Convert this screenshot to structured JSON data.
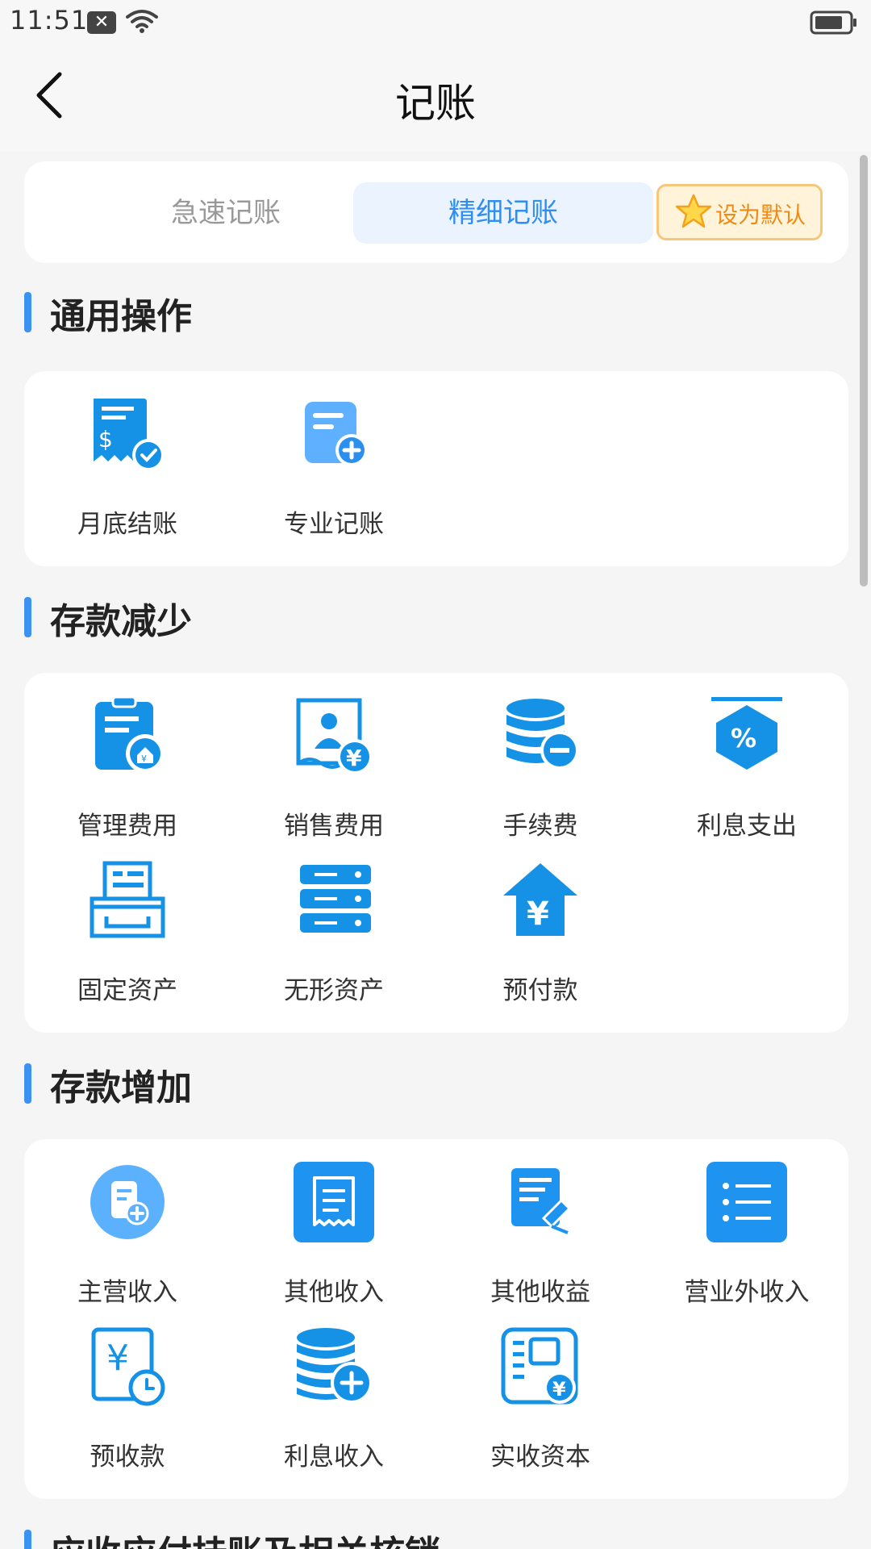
{
  "status_bar": {
    "time": "11:51",
    "notification_glyph": "✕"
  },
  "nav": {
    "title": "记账",
    "back_icon": "chevron-left-icon"
  },
  "mode_tabs": {
    "quick": "急速记账",
    "fine": "精细记账",
    "default_label": "设为默认"
  },
  "colors": {
    "accent": "#2f8ff0",
    "icon_blue": "#1592e6",
    "warning": "#f08a14"
  },
  "sections": {
    "general": {
      "title": "通用操作",
      "items": [
        {
          "label": "月底结账",
          "icon": "receipt-check-icon"
        },
        {
          "label": "专业记账",
          "icon": "document-add-icon"
        }
      ]
    },
    "decrease": {
      "title": "存款减少",
      "items": [
        {
          "label": "管理费用",
          "icon": "clipboard-home-icon"
        },
        {
          "label": "销售费用",
          "icon": "salesperson-yen-icon"
        },
        {
          "label": "手续费",
          "icon": "coin-stack-minus-icon"
        },
        {
          "label": "利息支出",
          "icon": "percent-tag-icon"
        },
        {
          "label": "固定资产",
          "icon": "printer-icon"
        },
        {
          "label": "无形资产",
          "icon": "server-icon"
        },
        {
          "label": "预付款",
          "icon": "house-yen-icon"
        }
      ]
    },
    "increase": {
      "title": "存款增加",
      "items": [
        {
          "label": "主营收入",
          "icon": "circle-document-add-icon"
        },
        {
          "label": "其他收入",
          "icon": "receipt-icon"
        },
        {
          "label": "其他收益",
          "icon": "document-edit-icon"
        },
        {
          "label": "营业外收入",
          "icon": "list-icon"
        },
        {
          "label": "预收款",
          "icon": "yen-clock-icon"
        },
        {
          "label": "利息收入",
          "icon": "coin-stack-plus-icon"
        },
        {
          "label": "实收资本",
          "icon": "form-yen-icon"
        }
      ]
    },
    "next": {
      "title": "应收应付挂账及相关核销"
    }
  }
}
